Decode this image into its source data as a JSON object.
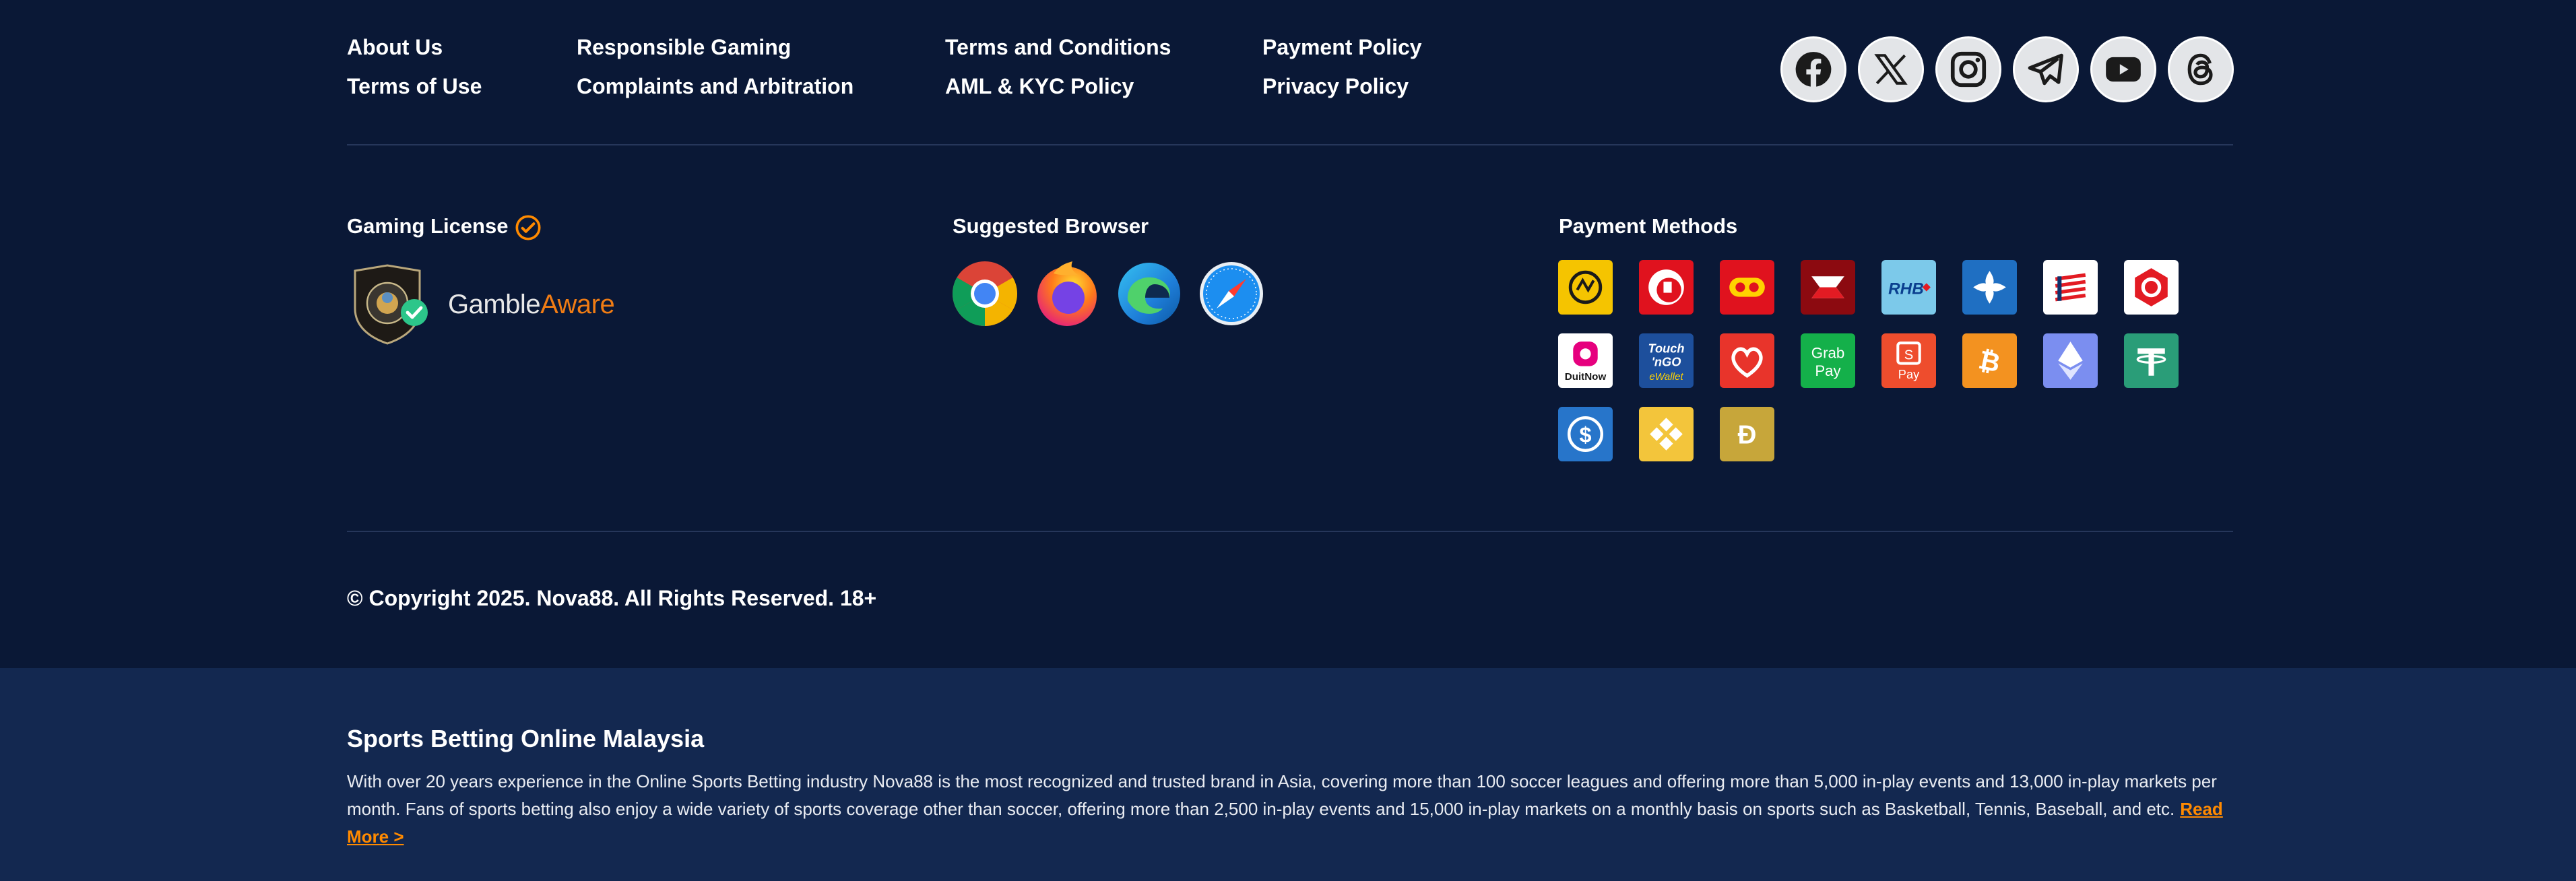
{
  "links": {
    "col1": [
      "About Us",
      "Terms of Use"
    ],
    "col2": [
      "Responsible Gaming",
      "Complaints and Arbitration"
    ],
    "col3": [
      "Terms and Conditions",
      "AML & KYC Policy"
    ],
    "col4": [
      "Payment Policy",
      "Privacy Policy"
    ]
  },
  "socials": [
    "facebook-icon",
    "x-twitter-icon",
    "instagram-icon",
    "telegram-icon",
    "youtube-icon",
    "threads-icon"
  ],
  "license": {
    "title": "Gaming License",
    "badge_icon": "verified-check-icon",
    "gamble_part1": "Gamble",
    "gamble_part2": "Aware"
  },
  "browsers": {
    "title": "Suggested Browser",
    "items": [
      "chrome-icon",
      "firefox-icon",
      "edge-icon",
      "safari-icon"
    ]
  },
  "payments": {
    "title": "Payment Methods",
    "items": [
      {
        "name": "maybank",
        "bg": "#f5c400"
      },
      {
        "name": "publicbank",
        "bg": "#e0121e"
      },
      {
        "name": "ambank",
        "bg": "#e0121e"
      },
      {
        "name": "cimb",
        "bg": "#8c0a10"
      },
      {
        "name": "rhb",
        "bg": "#7cc9ea",
        "label": "RHB"
      },
      {
        "name": "bankislam",
        "bg": "#1f6fc2"
      },
      {
        "name": "hongleong",
        "bg": "#ffffff"
      },
      {
        "name": "bsn",
        "bg": "#ffffff"
      },
      {
        "name": "duitnow",
        "bg": "#ffffff",
        "label": "DuitNow"
      },
      {
        "name": "touchngo",
        "bg": "#1d4f9c",
        "label1": "Touch",
        "label2": "'nGO",
        "label3": "eWallet"
      },
      {
        "name": "boost",
        "bg": "#e8342b"
      },
      {
        "name": "grabpay",
        "bg": "#14b04a",
        "label1": "Grab",
        "label2": "Pay"
      },
      {
        "name": "shopeepay",
        "bg": "#ee4d2d",
        "label": "Pay"
      },
      {
        "name": "bitcoin",
        "bg": "#f39220"
      },
      {
        "name": "ethereum",
        "bg": "#7b8ef0"
      },
      {
        "name": "tether",
        "bg": "#2a9d78"
      },
      {
        "name": "usdc",
        "bg": "#2775ca"
      },
      {
        "name": "bnb",
        "bg": "#f3c53b"
      },
      {
        "name": "dogecoin",
        "bg": "#c7a63a"
      }
    ]
  },
  "copyright": "© Copyright 2025. Nova88. All Rights Reserved. 18+",
  "seo": {
    "title": "Sports Betting Online Malaysia",
    "text": "With over 20 years experience in the Online Sports Betting industry Nova88 is the most recognized and trusted brand in Asia, covering more than 100 soccer leagues and offering more than 5,000 in-play events and 13,000 in-play markets per month. Fans of sports betting also enjoy a wide variety of sports coverage other than soccer, offering more than 2,500 in-play events and 15,000 in-play markets on a monthly basis on sports such as Basketball, Tennis, Baseball, and etc.",
    "read_more": "Read More >"
  },
  "colors": {
    "background": "#0a1836",
    "seo_background": "#132850",
    "accent": "#ff8a00"
  }
}
